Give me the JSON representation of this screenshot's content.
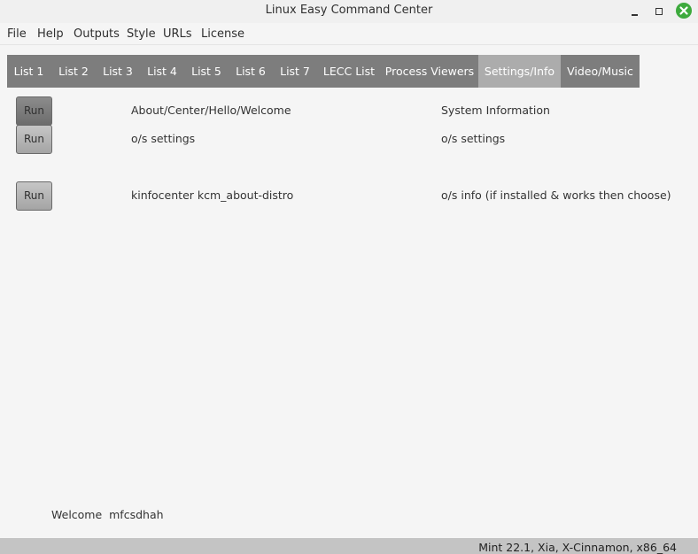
{
  "window": {
    "title": "Linux Easy Command Center",
    "close_color": "#3daa3d"
  },
  "menu": [
    "File",
    "Help",
    "Outputs",
    "Style",
    "URLs",
    "License"
  ],
  "tabs": [
    "List 1",
    "List 2",
    "List 3",
    "List 4",
    "List 5",
    "List 6",
    "List 7",
    "LECC List",
    "Process Viewers",
    "Settings/Info",
    "Video/Music"
  ],
  "active_tab": "Settings/Info",
  "rows": [
    {
      "button": "Run",
      "command": "About/Center/Hello/Welcome",
      "description": "System Information"
    },
    {
      "button": "Run",
      "command": "o/s settings",
      "description": "o/s settings"
    },
    {
      "button": "Run",
      "command": "kinfocenter kcm_about-distro",
      "description": "o/s info (if installed & works then choose)"
    }
  ],
  "welcome": "Welcome  mfcsdhah",
  "status": "Mint 22.1, Xia, X-Cinnamon, x86_64"
}
